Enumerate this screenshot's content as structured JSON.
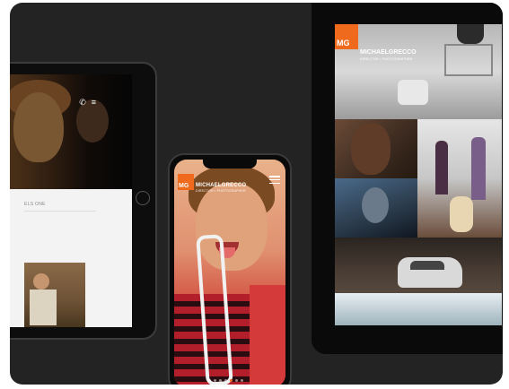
{
  "left_tablet": {
    "caption": "ELS ONE",
    "icons": [
      "phone-icon",
      "menu-icon"
    ]
  },
  "phone": {
    "logo": "MG",
    "brand": "MICHAELGRECCO",
    "subtitle": "DIRECTOR • PHOTOGRAPHER",
    "icons": [
      "menu-icon"
    ],
    "pager": {
      "total": 7,
      "active_index": 4
    }
  },
  "right_tablet": {
    "logo": "MG",
    "brand": "MICHAELGRECCO",
    "subtitle": "DIRECTOR • PHOTOGRAPHER"
  },
  "colors": {
    "accent": "#ef6a1c",
    "stage": "#232323"
  }
}
